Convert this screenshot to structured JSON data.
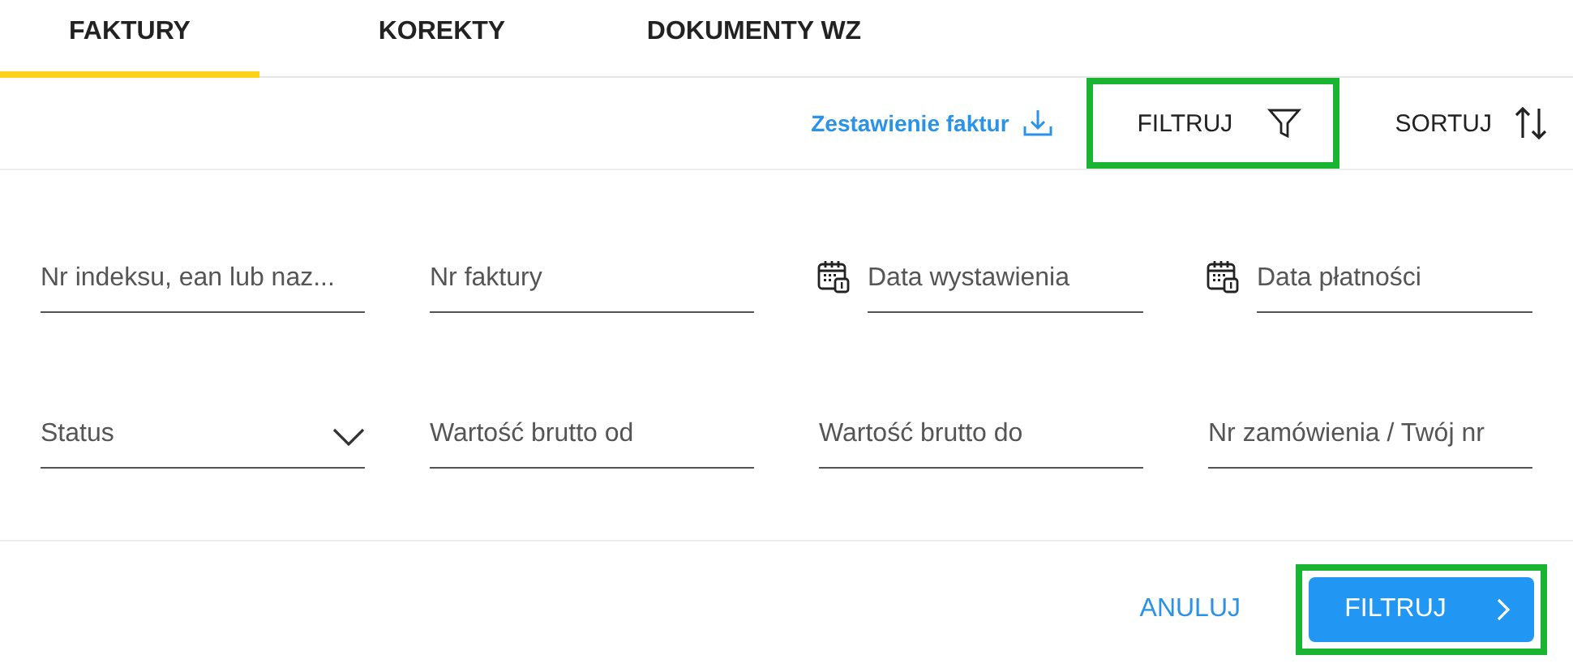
{
  "tabs": [
    {
      "label": "FAKTURY",
      "selected": true
    },
    {
      "label": "KOREKTY",
      "selected": false
    },
    {
      "label": "DOKUMENTY WZ",
      "selected": false
    }
  ],
  "toolbar": {
    "report_link": "Zestawienie faktur",
    "filter": {
      "label": "FILTRUJ",
      "highlighted": true
    },
    "sort": {
      "label": "SORTUJ"
    }
  },
  "filters": [
    {
      "kind": "text",
      "placeholder": "Nr indeksu, ean lub naz..."
    },
    {
      "kind": "text",
      "placeholder": "Nr faktury"
    },
    {
      "kind": "date",
      "placeholder": "Data wystawienia"
    },
    {
      "kind": "date",
      "placeholder": "Data płatności"
    },
    {
      "kind": "select",
      "placeholder": "Status"
    },
    {
      "kind": "text",
      "placeholder": "Wartość brutto od"
    },
    {
      "kind": "text",
      "placeholder": "Wartość brutto do"
    },
    {
      "kind": "text",
      "placeholder": "Nr zamówienia / Twój nr"
    }
  ],
  "actions": {
    "cancel": "ANULUJ",
    "submit": {
      "label": "FILTRUJ",
      "highlighted": true
    }
  }
}
